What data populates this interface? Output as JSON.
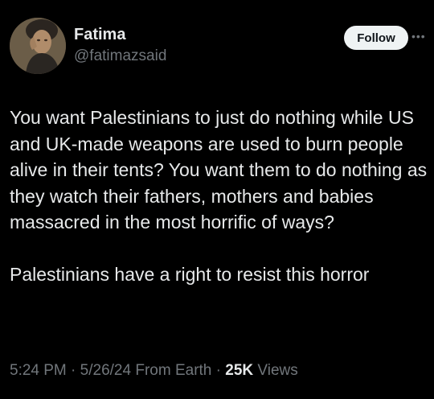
{
  "author": {
    "display_name": "Fatima",
    "handle": "@fatimazsaid"
  },
  "follow_label": "Follow",
  "more_icon": "more-horizontal-icon",
  "tweet": {
    "paragraphs": [
      "You want Palestinians to just do nothing while US and UK-made weapons are used to burn people alive in their tents? You want them to do nothing as they watch their fathers, mothers and babies massacred in the most horrific of ways?",
      "Palestinians have a right to resist this horror"
    ]
  },
  "meta": {
    "time": "5:24 PM",
    "separator": "·",
    "date": "5/26/24",
    "source": "From Earth",
    "views_count": "25K",
    "views_label": "Views"
  },
  "colors": {
    "background": "#000000",
    "text": "#e7e9ea",
    "secondary": "#71767b",
    "follow_bg": "#eff3f4"
  }
}
